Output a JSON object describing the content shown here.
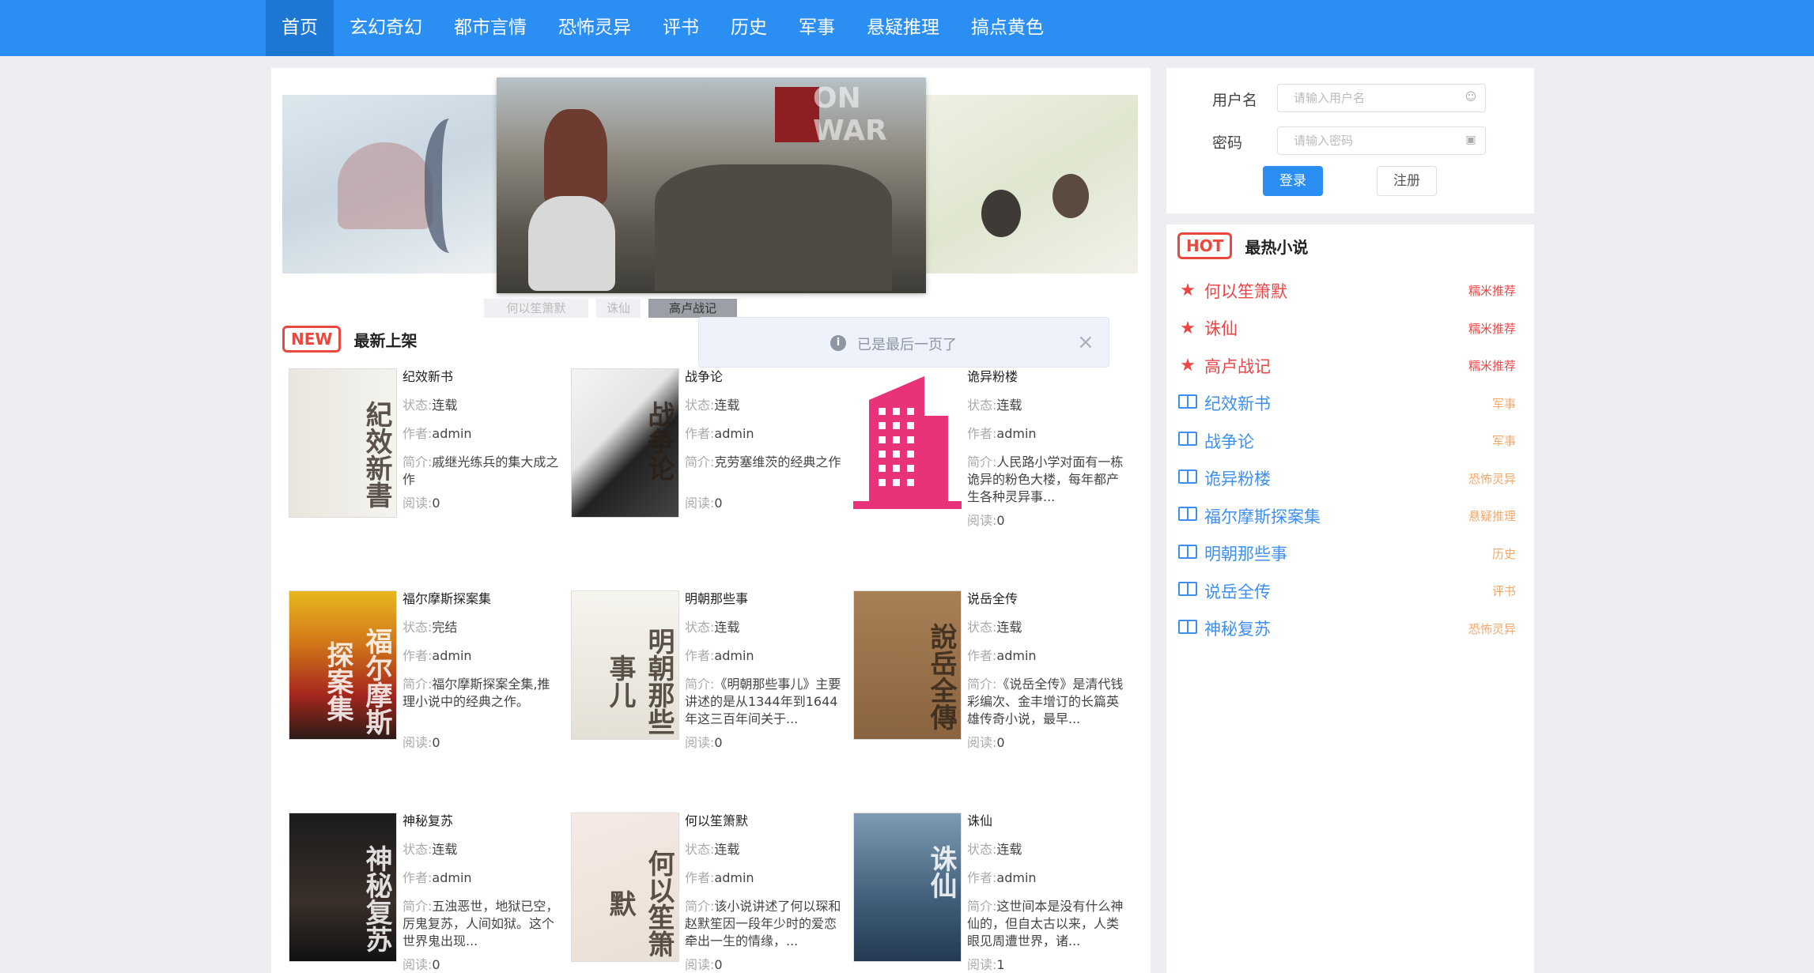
{
  "nav": {
    "items": [
      "首页",
      "玄幻奇幻",
      "都市言情",
      "恐怖灵异",
      "评书",
      "历史",
      "军事",
      "悬疑推理",
      "搞点黄色"
    ],
    "active_index": 0
  },
  "carousel": {
    "indicators": [
      "何以笙箫默",
      "诛仙",
      "高卢战记"
    ],
    "active_index": 2,
    "watermark": "ON WAR"
  },
  "latest": {
    "badge": "NEW",
    "title": "最新上架",
    "labels": {
      "status": "状态:",
      "author": "作者:",
      "summary": "简介:",
      "reads": "阅读:"
    },
    "books": [
      {
        "title": "纪效新书",
        "status": "连载",
        "author": "admin",
        "summary": "戚继光练兵的集大成之作",
        "reads": "0",
        "cover": "c-ancient",
        "cover_text": "紀效新書"
      },
      {
        "title": "战争论",
        "status": "连载",
        "author": "admin",
        "summary": "克劳塞维茨的经典之作",
        "reads": "0",
        "cover": "c-war",
        "cover_text": "战争论"
      },
      {
        "title": "诡异粉楼",
        "status": "连载",
        "author": "admin",
        "summary": "人民路小学对面有一栋诡异的粉色大楼，每年都产生各种灵异事...",
        "reads": "0",
        "cover": "c-pink",
        "cover_text": ""
      },
      {
        "title": "福尔摩斯探案集",
        "status": "完结",
        "author": "admin",
        "summary": "福尔摩斯探案全集,推理小说中的经典之作。",
        "reads": "0",
        "cover": "c-holmes",
        "cover_text": "福尔摩斯探案集"
      },
      {
        "title": "明朝那些事",
        "status": "连载",
        "author": "admin",
        "summary": "《明朝那些事儿》主要讲述的是从1344年到1644年这三百年间关于...",
        "reads": "0",
        "cover": "c-ming",
        "cover_text": "明朝那些事儿"
      },
      {
        "title": "说岳全传",
        "status": "连载",
        "author": "admin",
        "summary": "《说岳全传》是清代钱彩编次、金丰增订的长篇英雄传奇小说，最早...",
        "reads": "0",
        "cover": "c-yue",
        "cover_text": "說岳全傳"
      },
      {
        "title": "神秘复苏",
        "status": "连载",
        "author": "admin",
        "summary": "五浊恶世，地狱已空，厉鬼复苏，人间如狱。这个世界鬼出现...",
        "reads": "0",
        "cover": "c-myst",
        "cover_text": "神秘复苏"
      },
      {
        "title": "何以笙箫默",
        "status": "连载",
        "author": "admin",
        "summary": "该小说讲述了何以琛和赵默笙因一段年少时的爱恋牵出一生的情缘，...",
        "reads": "0",
        "cover": "c-flower",
        "cover_text": "何以笙箫默"
      },
      {
        "title": "诛仙",
        "status": "连载",
        "author": "admin",
        "summary": "这世间本是没有什么神仙的，但自太古以来，人类眼见周遭世界，诸...",
        "reads": "1",
        "cover": "c-zx",
        "cover_text": "诛仙"
      }
    ]
  },
  "toast": {
    "message": "已是最后一页了",
    "close": "×"
  },
  "login": {
    "username_label": "用户名",
    "username_placeholder": "请输入用户名",
    "password_label": "密码",
    "password_placeholder": "请输入密码",
    "login_button": "登录",
    "register_button": "注册"
  },
  "hot": {
    "badge": "HOT",
    "title": "最热小说",
    "items": [
      {
        "name": "何以笙箫默",
        "category": "糯米推荐",
        "type": "rec"
      },
      {
        "name": "诛仙",
        "category": "糯米推荐",
        "type": "rec"
      },
      {
        "name": "高卢战记",
        "category": "糯米推荐",
        "type": "rec"
      },
      {
        "name": "纪效新书",
        "category": "军事",
        "type": "norm"
      },
      {
        "name": "战争论",
        "category": "军事",
        "type": "norm"
      },
      {
        "name": "诡异粉楼",
        "category": "恐怖灵异",
        "type": "norm"
      },
      {
        "name": "福尔摩斯探案集",
        "category": "悬疑推理",
        "type": "norm"
      },
      {
        "name": "明朝那些事",
        "category": "历史",
        "type": "norm"
      },
      {
        "name": "说岳全传",
        "category": "评书",
        "type": "norm"
      },
      {
        "name": "神秘复苏",
        "category": "恐怖灵异",
        "type": "norm"
      }
    ]
  },
  "colors": {
    "primary": "#2b8ef2",
    "hot_red": "#ec4545",
    "link_blue": "#3d8ff2",
    "category_orange": "#f3a86b"
  }
}
